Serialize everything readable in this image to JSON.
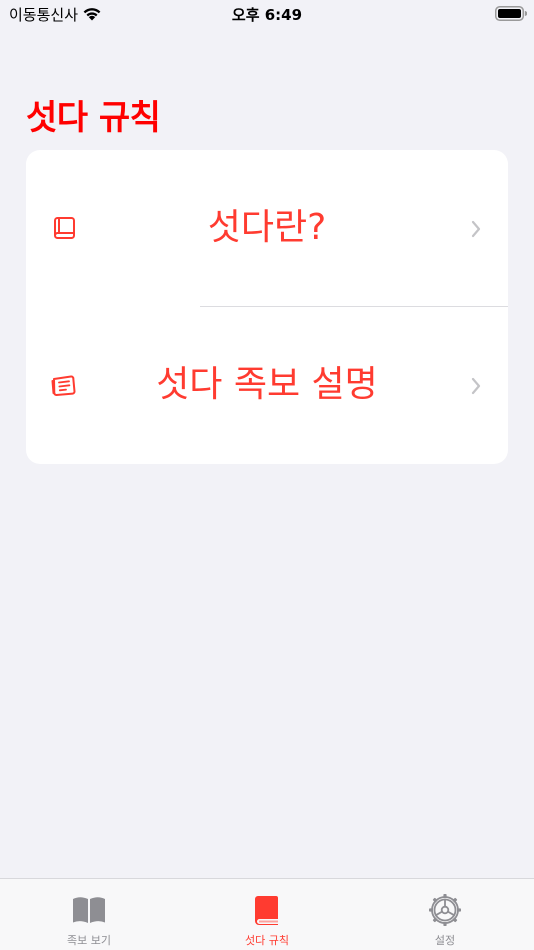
{
  "status_bar": {
    "carrier": "이동통신사",
    "time": "오후 6:49"
  },
  "page": {
    "title": "섯다 규칙"
  },
  "menu": {
    "items": [
      {
        "label": "섯다란?",
        "icon": "book-icon"
      },
      {
        "label": "섯다 족보 설명",
        "icon": "notebook-icon"
      }
    ]
  },
  "tab_bar": {
    "tabs": [
      {
        "label": "족보 보기",
        "icon": "open-book-icon",
        "active": false
      },
      {
        "label": "섯다 규칙",
        "icon": "closed-book-icon",
        "active": true
      },
      {
        "label": "설정",
        "icon": "gear-icon",
        "active": false
      }
    ]
  },
  "colors": {
    "accent": "#ff3b30",
    "title": "#ff0000",
    "inactive": "#8e8e93",
    "background": "#f2f2f7"
  }
}
